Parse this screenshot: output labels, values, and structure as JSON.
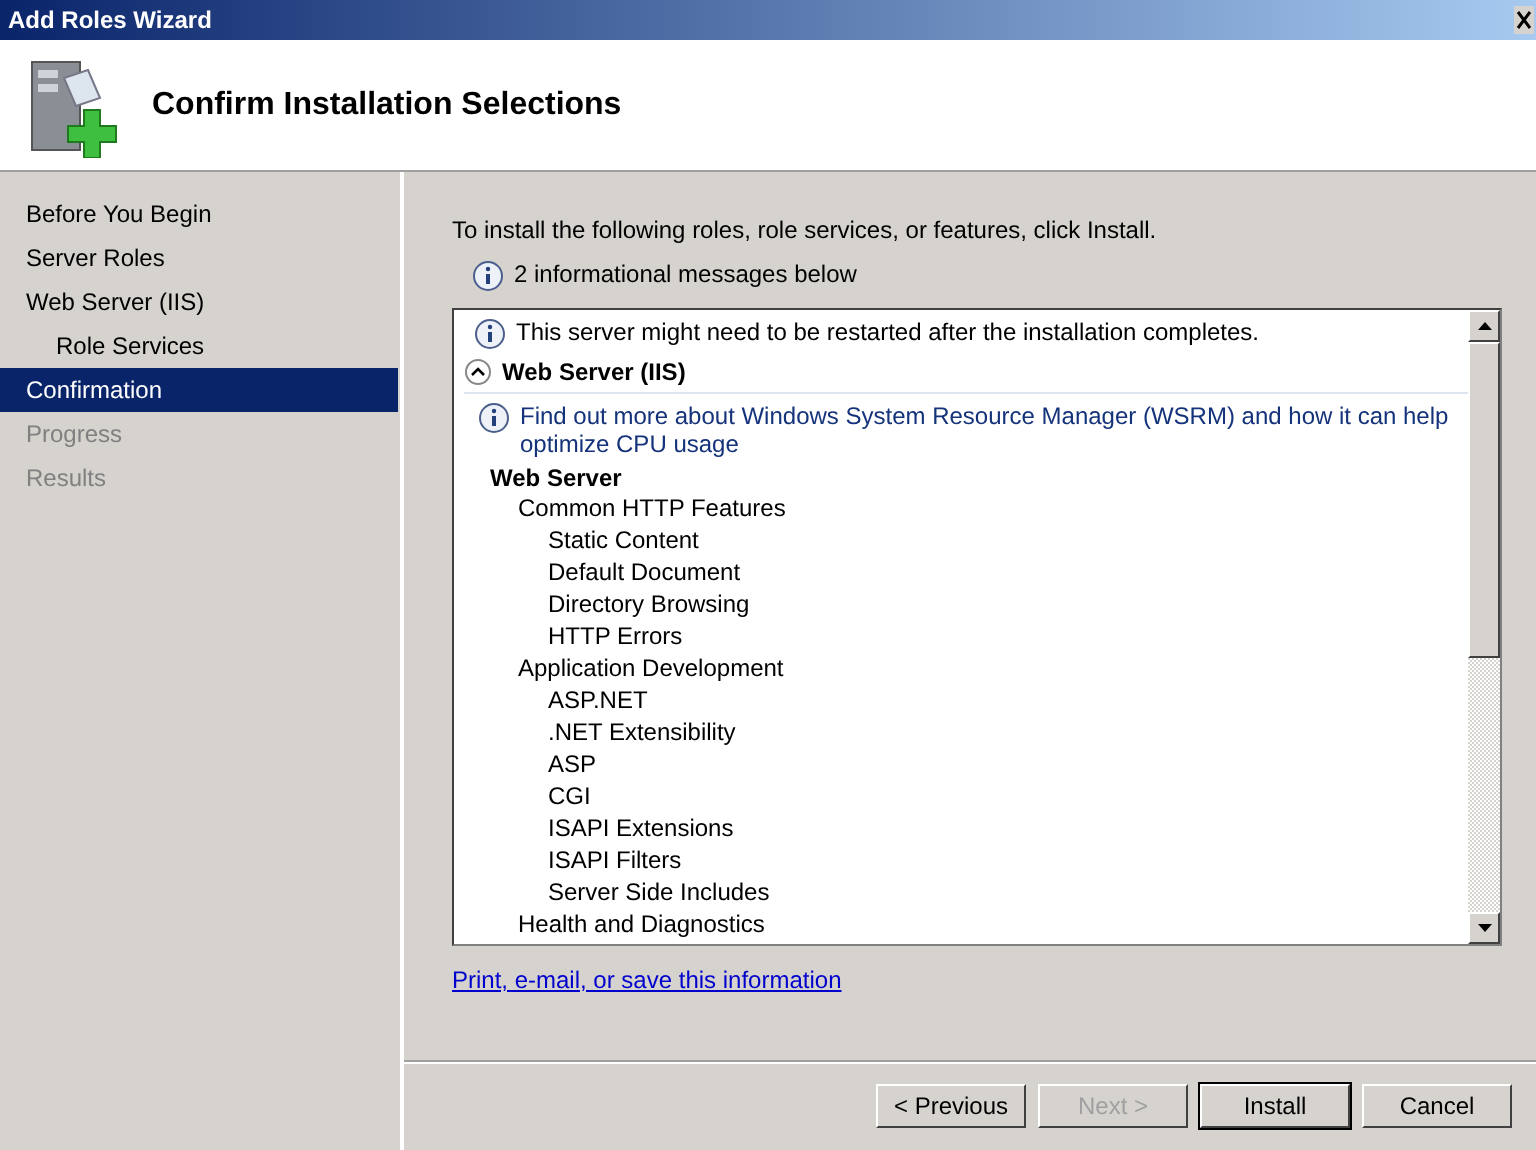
{
  "window": {
    "title": "Add Roles Wizard"
  },
  "header": {
    "title": "Confirm Installation Selections"
  },
  "sidebar": {
    "items": [
      {
        "label": "Before You Begin",
        "selected": false,
        "disabled": false
      },
      {
        "label": "Server Roles",
        "selected": false,
        "disabled": false
      },
      {
        "label": "Web Server (IIS)",
        "selected": false,
        "disabled": false,
        "children": [
          {
            "label": "Role Services",
            "selected": false,
            "disabled": false
          }
        ]
      },
      {
        "label": "Confirmation",
        "selected": true,
        "disabled": false
      },
      {
        "label": "Progress",
        "selected": false,
        "disabled": true
      },
      {
        "label": "Results",
        "selected": false,
        "disabled": true
      }
    ]
  },
  "main": {
    "intro": "To install the following roles, role services, or features, click Install.",
    "info_summary": "2 informational messages below",
    "details": {
      "message": "This server might need to be restarted after the installation completes.",
      "section": {
        "title": "Web Server (IIS)",
        "expanded": true,
        "info_link": "Find out more about Windows System Resource Manager (WSRM) and how it can help optimize CPU usage",
        "groups": [
          {
            "title": "Web Server",
            "children": [
              {
                "label": "Common HTTP Features",
                "children": [
                  {
                    "label": "Static Content"
                  },
                  {
                    "label": "Default Document"
                  },
                  {
                    "label": "Directory Browsing"
                  },
                  {
                    "label": "HTTP Errors"
                  }
                ]
              },
              {
                "label": "Application Development",
                "children": [
                  {
                    "label": "ASP.NET"
                  },
                  {
                    "label": ".NET Extensibility"
                  },
                  {
                    "label": "ASP"
                  },
                  {
                    "label": "CGI"
                  },
                  {
                    "label": "ISAPI Extensions"
                  },
                  {
                    "label": "ISAPI Filters"
                  },
                  {
                    "label": "Server Side Includes"
                  }
                ]
              },
              {
                "label": "Health and Diagnostics"
              }
            ]
          }
        ]
      }
    },
    "link": "Print, e-mail, or save this information"
  },
  "buttons": [
    {
      "label": "< Previous",
      "disabled": false,
      "default": false
    },
    {
      "label": "Next >",
      "disabled": true,
      "default": false
    },
    {
      "label": "Install",
      "disabled": false,
      "default": true
    },
    {
      "label": "Cancel",
      "disabled": false,
      "default": false
    }
  ]
}
